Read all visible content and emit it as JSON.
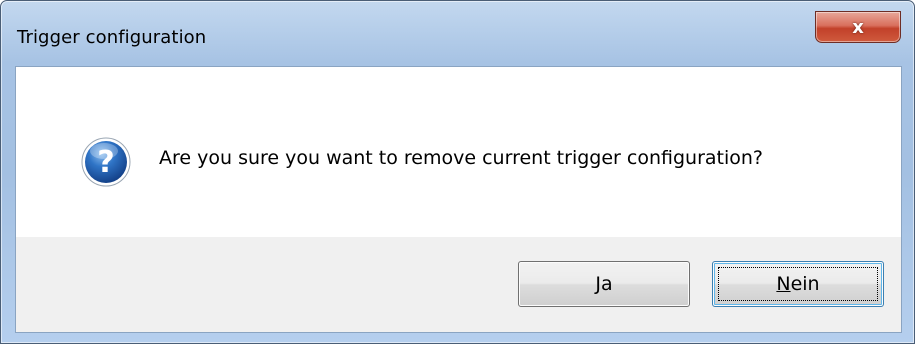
{
  "window": {
    "title": "Trigger configuration",
    "close_glyph": "x"
  },
  "dialog": {
    "icon": "question-icon",
    "message": "Are you sure you want to remove current trigger configuration?"
  },
  "buttons": {
    "yes": {
      "mnemonic": "J",
      "rest": "a"
    },
    "no": {
      "mnemonic": "N",
      "rest": "ein"
    }
  },
  "colors": {
    "frame": "#a7c3e4",
    "close_button": "#c2412a",
    "icon_blue": "#1d5fb0",
    "button_bar": "#f0f0f0"
  }
}
